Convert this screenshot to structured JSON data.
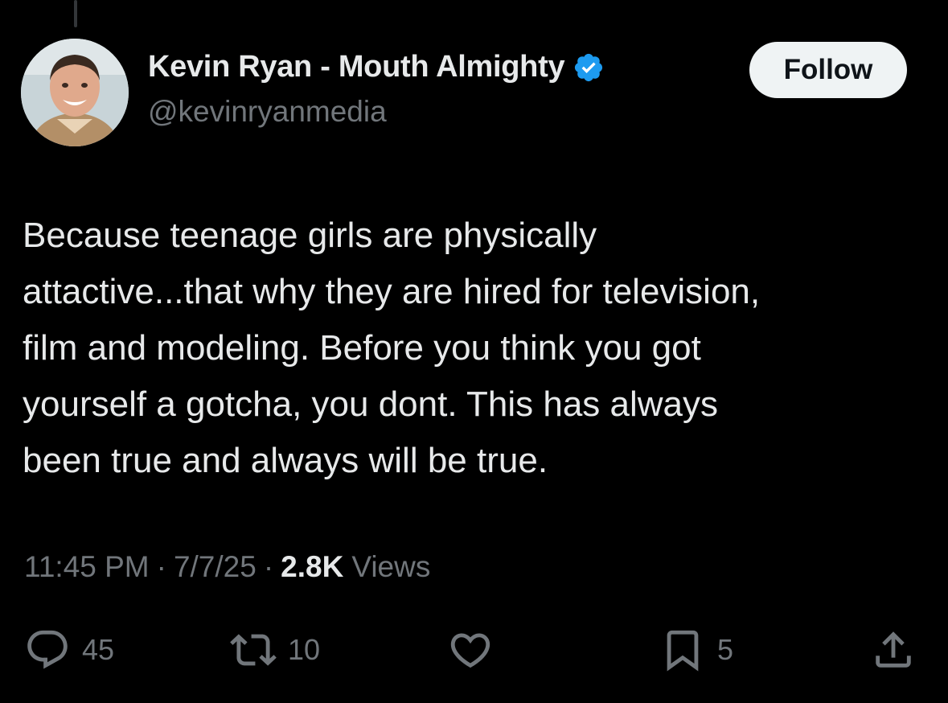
{
  "author": {
    "display_name": "Kevin Ryan - Mouth Almighty",
    "handle": "@kevinryanmedia",
    "verified": true,
    "verified_color": "#1d9bf0"
  },
  "follow_button": {
    "label": "Follow"
  },
  "tweet": {
    "text": "Because teenage girls are physically\nattactive...that why they are hired for television,\nfilm and modeling.  Before you think you got\nyourself a gotcha, you dont.  This has always\nbeen true and always will be true."
  },
  "meta": {
    "time": "11:45 PM",
    "separator": "·",
    "date": "7/7/25",
    "views_count": "2.8K",
    "views_label": "Views"
  },
  "actions": {
    "reply": {
      "icon": "reply-icon",
      "count": "45"
    },
    "repost": {
      "icon": "repost-icon",
      "count": "10"
    },
    "like": {
      "icon": "heart-icon",
      "count": ""
    },
    "bookmark": {
      "icon": "bookmark-icon",
      "count": "5"
    },
    "share": {
      "icon": "share-icon"
    }
  },
  "colors": {
    "background": "#000000",
    "primary_text": "#e7e9ea",
    "secondary_text": "#71767b",
    "follow_button_bg": "#eff3f4"
  }
}
